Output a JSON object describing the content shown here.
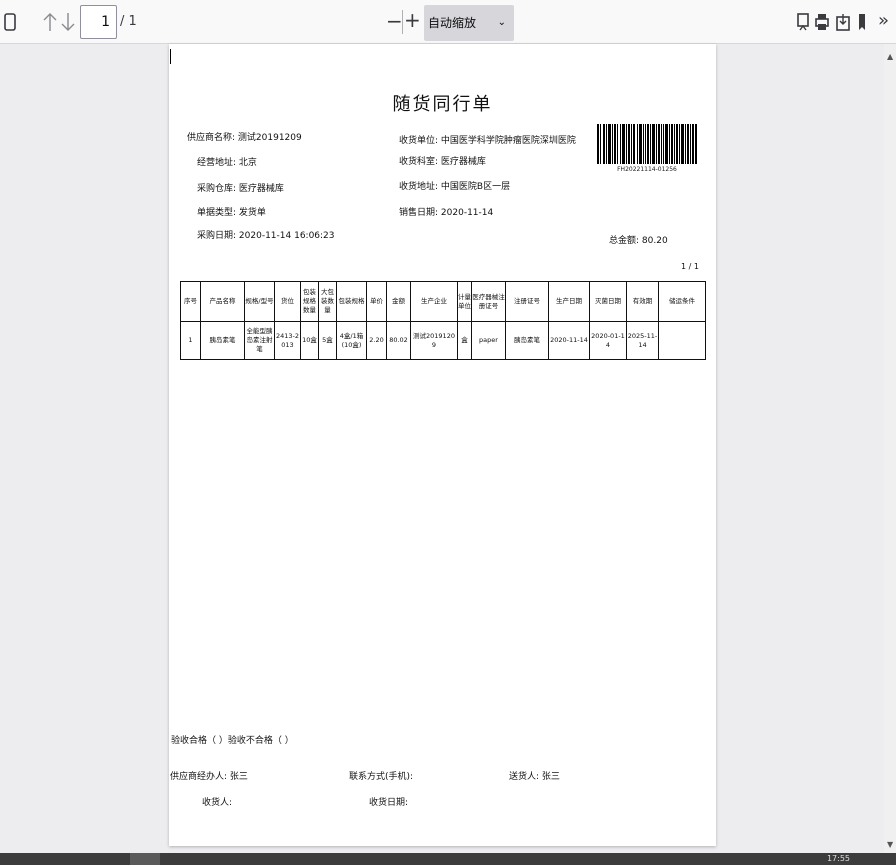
{
  "toolbar": {
    "current_page": "1",
    "total_pages": "/ 1",
    "zoom_minus": "−",
    "zoom_plus": "+",
    "zoom_label": "自动缩放"
  },
  "document": {
    "title": "随货同行单",
    "barcode_text": "FH20221114-01256",
    "left_fields": [
      {
        "label": "供应商名称:",
        "value": "测试20191209"
      },
      {
        "label": "经营地址:",
        "value": "北京"
      },
      {
        "label": "采购仓库:",
        "value": "医疗器械库"
      },
      {
        "label": "单据类型:",
        "value": "发货单"
      },
      {
        "label": "采购日期:",
        "value": "2020-11-14 16:06:23"
      }
    ],
    "right_fields": [
      {
        "label": "收货单位:",
        "value": "中国医学科学院肿瘤医院深圳医院"
      },
      {
        "label": "收货科室:",
        "value": "医疗器械库"
      },
      {
        "label": "收货地址:",
        "value": "中国医院B区一层"
      },
      {
        "label": "销售日期:",
        "value": "2020-11-14"
      }
    ],
    "total_amount_label": "总金额:",
    "total_amount": "80.20",
    "page_indicator": "1 / 1",
    "table": {
      "headers": [
        "序号",
        "产品名称",
        "规格/型号",
        "货位",
        "包装规格数量",
        "大包装数量",
        "包装规格",
        "单价",
        "金额",
        "生产企业",
        "计量单位",
        "医疗器械注册证号",
        "注册证号",
        "生产日期",
        "灭菌日期",
        "有效期",
        "储运条件"
      ],
      "rows": [
        [
          "1",
          "胰岛素笔",
          "全能型胰岛素注射笔",
          "2413-2013",
          "10盒",
          "5盒",
          "4盒/1箱(10盒)",
          "2.20",
          "80.02",
          "测试20191209",
          "盒",
          "paper",
          "胰岛素笔",
          "2020-11-14",
          "2020-01-14",
          "2025-11-14",
          ""
        ]
      ]
    },
    "footer": {
      "inspection": "验收合格（    ）验收不合格（    ）",
      "supplier_contact_label": "供应商经办人:",
      "supplier_contact": "张三",
      "phone_label": "联系方式(手机):",
      "shipper_label": "送货人:",
      "shipper": "张三",
      "receiver_label": "收货人:",
      "receive_date_label": "收货日期:"
    }
  },
  "taskbar": {
    "clock": "17:55"
  }
}
